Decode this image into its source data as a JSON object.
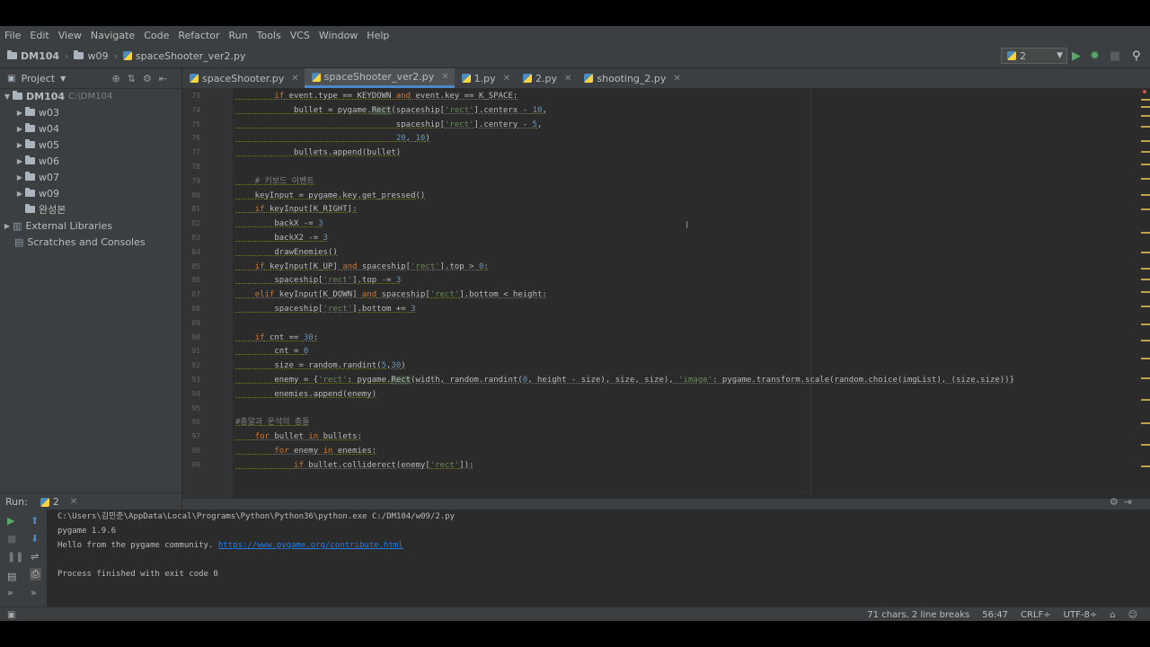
{
  "menu": [
    "File",
    "Edit",
    "View",
    "Navigate",
    "Code",
    "Refactor",
    "Run",
    "Tools",
    "VCS",
    "Window",
    "Help"
  ],
  "breadcrumb": {
    "project": "DM104",
    "folder": "w09",
    "file": "spaceShooter_ver2.py"
  },
  "run_config": {
    "label": "2"
  },
  "project_panel": {
    "title": "Project",
    "root": {
      "label": "DM104",
      "hint": "C:\\DM104"
    },
    "folders": [
      "w03",
      "w04",
      "w05",
      "w06",
      "w07",
      "w09"
    ],
    "extra": "완성본",
    "external": "External Libraries",
    "scratches": "Scratches and Consoles"
  },
  "tabs": [
    {
      "label": "spaceShooter.py"
    },
    {
      "label": "spaceShooter_ver2.py"
    },
    {
      "label": "1.py"
    },
    {
      "label": "2.py"
    },
    {
      "label": "shooting_2.py"
    }
  ],
  "code_lines": [
    {
      "n": "73",
      "t": "        if event.type == KEYDOWN and event.key == K_SPACE:"
    },
    {
      "n": "74",
      "t": "            bullet = pygame.Rect(spaceship['rect'].centerx - 10,"
    },
    {
      "n": "75",
      "t": "                                 spaceship['rect'].centery - 5,"
    },
    {
      "n": "76",
      "t": "                                 20, 10)"
    },
    {
      "n": "77",
      "t": "            bullets.append(bullet)"
    },
    {
      "n": "78",
      "t": ""
    },
    {
      "n": "79",
      "t": "    # 키보드 이벤트"
    },
    {
      "n": "80",
      "t": "    keyInput = pygame.key.get_pressed()"
    },
    {
      "n": "81",
      "t": "    if keyInput[K_RIGHT]:"
    },
    {
      "n": "82",
      "t": "        backX -= 3"
    },
    {
      "n": "83",
      "t": "        backX2 -= 3"
    },
    {
      "n": "84",
      "t": "        drawEnemies()"
    },
    {
      "n": "85",
      "t": "    if keyInput[K_UP] and spaceship['rect'].top > 0:"
    },
    {
      "n": "86",
      "t": "        spaceship['rect'].top -= 3"
    },
    {
      "n": "87",
      "t": "    elif keyInput[K_DOWN] and spaceship['rect'].bottom < height:"
    },
    {
      "n": "88",
      "t": "        spaceship['rect'].bottom += 3"
    },
    {
      "n": "89",
      "t": ""
    },
    {
      "n": "90",
      "t": "    if cnt == 30:"
    },
    {
      "n": "91",
      "t": "        cnt = 0"
    },
    {
      "n": "92",
      "t": "        size = random.randint(5,30)"
    },
    {
      "n": "93",
      "t": "        enemy = {'rect': pygame.Rect(width, random.randint(0, height - size), size, size), 'image': pygame.transform.scale(random.choice(imgList), (size,size))}"
    },
    {
      "n": "94",
      "t": "        enemies.append(enemy)"
    },
    {
      "n": "95",
      "t": ""
    },
    {
      "n": "96",
      "t": "#총알과 운석의 충돌"
    },
    {
      "n": "97",
      "t": "    for bullet in bullets:"
    },
    {
      "n": "98",
      "t": "        for enemy in enemies:"
    },
    {
      "n": "99",
      "t": "            if bullet.colliderect(enemy['rect']):"
    }
  ],
  "run_panel": {
    "label": "Run:",
    "tab": "2",
    "output": [
      "C:\\Users\\김민준\\AppData\\Local\\Programs\\Python\\Python36\\python.exe C:/DM104/w09/2.py",
      "pygame 1.9.6",
      "Hello from the pygame community.",
      "",
      "Process finished with exit code 0"
    ],
    "link": "https://www.pygame.org/contribute.html"
  },
  "status": {
    "chars": "71 chars, 2 line breaks",
    "pos": "56:47",
    "eol": "CRLF÷",
    "enc": "UTF-8÷"
  },
  "colors": {
    "bg": "#3c3f41",
    "editor": "#2b2b2b",
    "accent": "#4a88c7",
    "keyword": "#cc7832",
    "string": "#6a8759",
    "number": "#6897bb"
  }
}
